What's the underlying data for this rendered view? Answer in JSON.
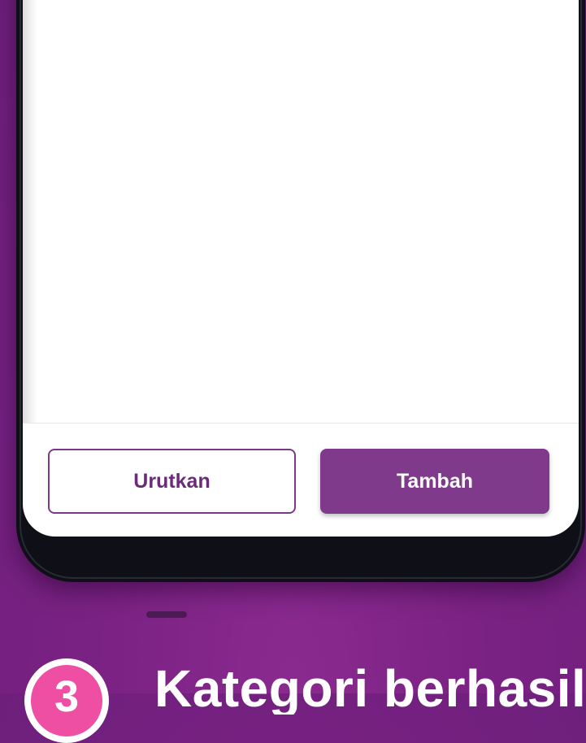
{
  "bottom_bar": {
    "sort_label": "Urutkan",
    "add_label": "Tambah"
  },
  "step": {
    "number": "3",
    "caption": "Kategori berhasil"
  },
  "colors": {
    "background": "#7b2284",
    "primary_button": "#7f3a8b",
    "secondary_border": "#7a3a85",
    "step_badge": "#ee4fa3"
  }
}
